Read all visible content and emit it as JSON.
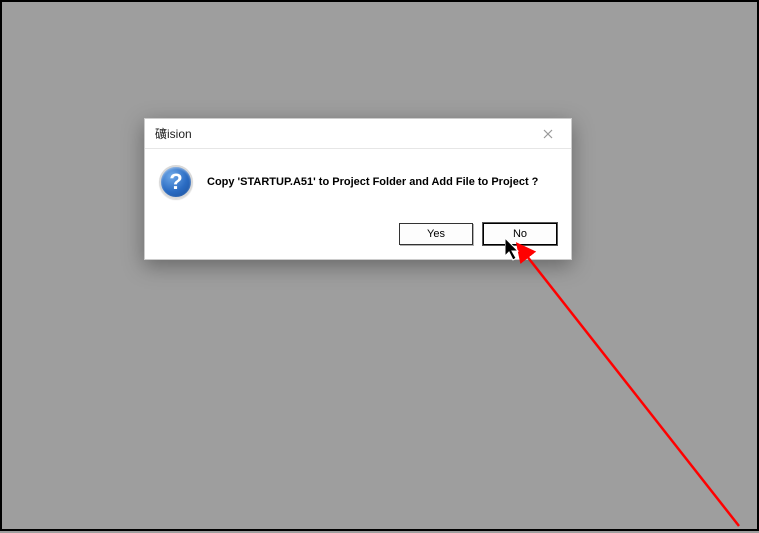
{
  "dialog": {
    "title": "礦ision",
    "message": "Copy 'STARTUP.A51' to Project Folder and Add File to Project ?",
    "buttons": {
      "yes": "Yes",
      "no": "No"
    }
  }
}
